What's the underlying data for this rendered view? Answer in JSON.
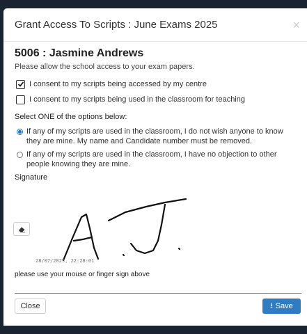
{
  "modal": {
    "title": "Grant Access To Scripts : June Exams 2025",
    "close_icon": "×"
  },
  "candidate": {
    "number": "5006",
    "separator": " : ",
    "name": "Jasmine Andrews",
    "instruction": "Please allow the school access to your exam papers."
  },
  "consents": [
    {
      "label": "I consent to my scripts being accessed by my centre",
      "checked": true
    },
    {
      "label": "I consent to my scripts being used in the classroom for teaching",
      "checked": false
    }
  ],
  "options": {
    "heading": "Select ONE of the options below:",
    "items": [
      {
        "label": "If any of my scripts are used in the classroom, I do not wish anyone to know they are mine. My name and Candidate number must be removed.",
        "selected": true
      },
      {
        "label": "If any of my scripts are used in the classroom, I have no objection to other people knowing they are mine.",
        "selected": false
      }
    ]
  },
  "signature": {
    "label": "Signature",
    "eraser_icon": "eraser-icon",
    "timestamp": "28/07/2025, 22:28:01",
    "help": "please use your mouse or finger sign above"
  },
  "footer": {
    "close_label": "Close",
    "save_label": "Save",
    "save_icon": "upload-icon"
  },
  "colors": {
    "accent": "#2f7cc3",
    "backdrop": "#1a2330"
  }
}
